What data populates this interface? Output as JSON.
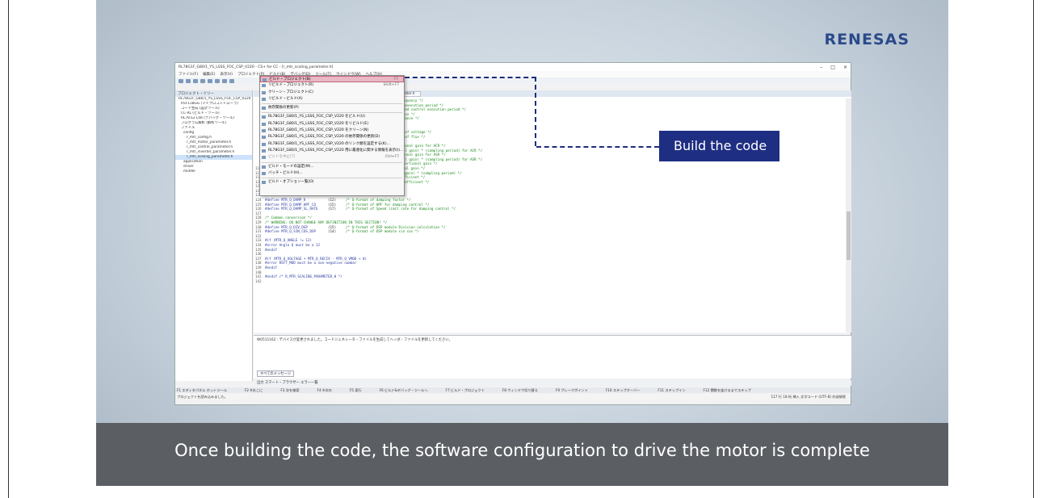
{
  "brand": {
    "logo": "RENESAS"
  },
  "caption": "Once building the code, the software configuration to drive the motor is complete",
  "callout": {
    "label": "Build the code",
    "color": "#1e2e82"
  },
  "ide": {
    "title": "RL78G1F_G80/1_YS_LSSS_FOC_CSP_V220 - CS+ for CC - [r_mtr_scaling_parameter.h]",
    "menu": [
      "ファイル(F)",
      "編集(E)",
      "表示(V)",
      "プロジェクト(P)",
      "ビルド(B)",
      "デバッグ(D)",
      "ツール(T)",
      "ウインドウ(W)",
      "ヘルプ(H)"
    ],
    "project_panel_title": "プロジェクト・ツリー",
    "tree": [
      "RL78G1F_G80/1_YS_LSSS_FOC_CSP_V220",
      "R5F11BGG (マイクロコントローラ)",
      "コード生成 (設計ツール)",
      "CC-RL (ビルド・ツール)",
      "RL78 E2 Lite (デバッグ・ツール)",
      "プログラム解析 (解析ツール)",
      "ファイル",
      "config",
      "r_mtr_config.h",
      "r_mtr_motor_parameter.h",
      "r_mtr_control_parameter.h",
      "r_mtr_inverter_parameter.h",
      "r_mtr_scaling_parameter.h",
      "application",
      "driver",
      "middle"
    ],
    "tabs": [
      "r_mtr_inverter_parameter.h",
      "r_mtr_scaling_parameter.h"
    ],
    "code_lines": [
      [
        "117",
        "#define MTR_Q_PLL_KP",
        "(17)",
        "/* Q-format of PLL proportional gain */"
      ],
      [
        "118",
        "#define MTR_Q_PLL_KIDT",
        "(21)",
        "/* Q-format of PLL (integral gain) * (sampling period) */"
      ],
      [
        "119",
        "#define MTR_Q_SPEED_LPF_CO",
        "(16)",
        "/* Q-format of speed LPF coefficient */"
      ],
      [
        "120",
        "#define MTR_Q_CURRENT_LPF_CO",
        "(15)",
        "/* Q-format of current LPF coefficient */"
      ],
      [
        "121",
        "",
        "",
        ""
      ],
      [
        "122",
        "",
        "",
        "/* Damping control quantities */"
      ],
      [
        "123",
        "",
        "",
        "/* WARNING: DO NOT CHANGE ANY DEFINITION IN THIS SECTION! */"
      ],
      [
        "124",
        "#define MTR_Q_DAMP_K",
        "(12)",
        "/* Q-format of damping factor */"
      ],
      [
        "125",
        "#define MTR_Q_DAMP_HPF_CO",
        "(15)",
        "/* Q-format of HPF for damping control */"
      ],
      [
        "126",
        "#define MTR_Q_DAMP_SL_RATE",
        "(17)",
        "/* Q-format of Speed limit rate for damping control */"
      ],
      [
        "127",
        "",
        "",
        ""
      ],
      [
        "128",
        "",
        "",
        "/* Common conversion */"
      ],
      [
        "129",
        "",
        "",
        "/* WARNING: DO NOT CHANGE ANY DEFINITION IN THIS SECTION! */"
      ],
      [
        "130",
        "#define MTR_Q_DIV_DSP",
        "(15)",
        "/* Q-format of DSP module Division calculation */"
      ],
      [
        "131",
        "#define MTR_Q_SIN_COS_DSP",
        "(14)",
        "/* Q-format of DSP module sin cos */"
      ],
      [
        "132",
        "",
        "",
        ""
      ],
      [
        "133",
        "#if (MTR_Q_ANGLE != 12)",
        "",
        ""
      ],
      [
        "134",
        "#error Angle Q must be a 12",
        "",
        ""
      ],
      [
        "135",
        "#endif",
        "",
        ""
      ],
      [
        "136",
        "",
        "",
        ""
      ],
      [
        "137",
        "#if (MTR_Q_VOLTAGE + MTR_Q_RECIV - MTR_Q_VMOD < 0)",
        "",
        ""
      ],
      [
        "138",
        "#error RSFT_MOD must be a non-negative number",
        "",
        ""
      ],
      [
        "139",
        "#endif",
        "",
        ""
      ],
      [
        "140",
        "",
        "",
        ""
      ],
      [
        "141",
        "#endif /* R_MTR_SCALING_PARAMETER_H */",
        "",
        ""
      ],
      [
        "142",
        "",
        "",
        ""
      ]
    ],
    "upper_comments": [
      "angular frequency */",
      "of control execution period */",
      "rmat of speed control execution period */",
      "of resistance */",
      "t of inductance */",
      "of flux */",
      "rrena */",
      "reciprocal of voltage */",
      "reciprocal of flux */",
      "",
      "PI proportional gain for ACR */",
      "PI (integral gain) * (sampling period) for ACR */",
      "PI proportional gain for ASR */",
      "PI (integral gain) * (sampling period) for ASR */",
      "of PLL proportional gain */"
    ],
    "output_text": "W0511162 : デバイスが変更されました。コードジェネレータ・ファイルを生成してヘッダ・ファイルを更新してください。",
    "output_tab": "すべてのメッセージ",
    "bottom_tabs": "出力  スマート・ブラウザー  エラー一覧",
    "fkeys": [
      "F1 エディタパネル ホットツール",
      "F2 ※おこに",
      "F3 次を検索",
      "F4 ※次の",
      "F5 実行",
      "F6 ビルド&デバッグ・ツールへ",
      "F7 ビルド・プロジェクト",
      "F8 ウィンドウ切り替え",
      "F9 ブレークポイント",
      "F10 ステップオーバー",
      "F11 ステップイン",
      "F12 関数を抜けるまでステップ"
    ],
    "status_left": "プロジェクトを読み込みました。",
    "status_right": "117 行   18 桁   挿入   文字コード (UTF-8)   外部接続"
  },
  "build_menu": [
    {
      "label": "ビルド・プロジェクト(B)",
      "shortcut": "F7",
      "highlighted": true
    },
    {
      "label": "リビルド・プロジェクト(R)",
      "shortcut": "Shift+F7"
    },
    {
      "label": "クリーン・プロジェクト(C)",
      "shortcut": ""
    },
    {
      "label": "リビルド・ビルド(A)",
      "shortcut": ""
    },
    {
      "sep": true
    },
    {
      "label": "依存関係の更新(P)",
      "shortcut": ""
    },
    {
      "sep": true
    },
    {
      "label": "RL78G1F_G80/1_YS_LSSS_FOC_CSP_V220 をビルド(U)",
      "shortcut": ""
    },
    {
      "label": "RL78G1F_G80/1_YS_LSSS_FOC_CSP_V220 をリビルド(E)",
      "shortcut": ""
    },
    {
      "label": "RL78G1F_G80/1_YS_LSSS_FOC_CSP_V220 をクリーン(N)",
      "shortcut": ""
    },
    {
      "label": "RL78G1F_G80/1_YS_LSSS_FOC_CSP_V220 の依存関係の更新(D)",
      "shortcut": ""
    },
    {
      "label": "RL78G1F_G80/1_YS_LSSS_FOC_CSP_V220 のリンク順を設定する(K)...",
      "shortcut": ""
    },
    {
      "label": "RL78G1F_G80/1_YS_LSSS_FOC_CSP_V220 用に最適化に関する情報を表示(I)...",
      "shortcut": ""
    },
    {
      "label": "ビルドを中止(T)",
      "shortcut": "Ctrl+F7",
      "disabled": true
    },
    {
      "sep": true
    },
    {
      "label": "ビルド・モードの設定(M)...",
      "shortcut": ""
    },
    {
      "label": "バッチ・ビルド(H)...",
      "shortcut": ""
    },
    {
      "sep": true
    },
    {
      "label": "ビルド・オプション一覧(O)",
      "shortcut": ""
    }
  ]
}
